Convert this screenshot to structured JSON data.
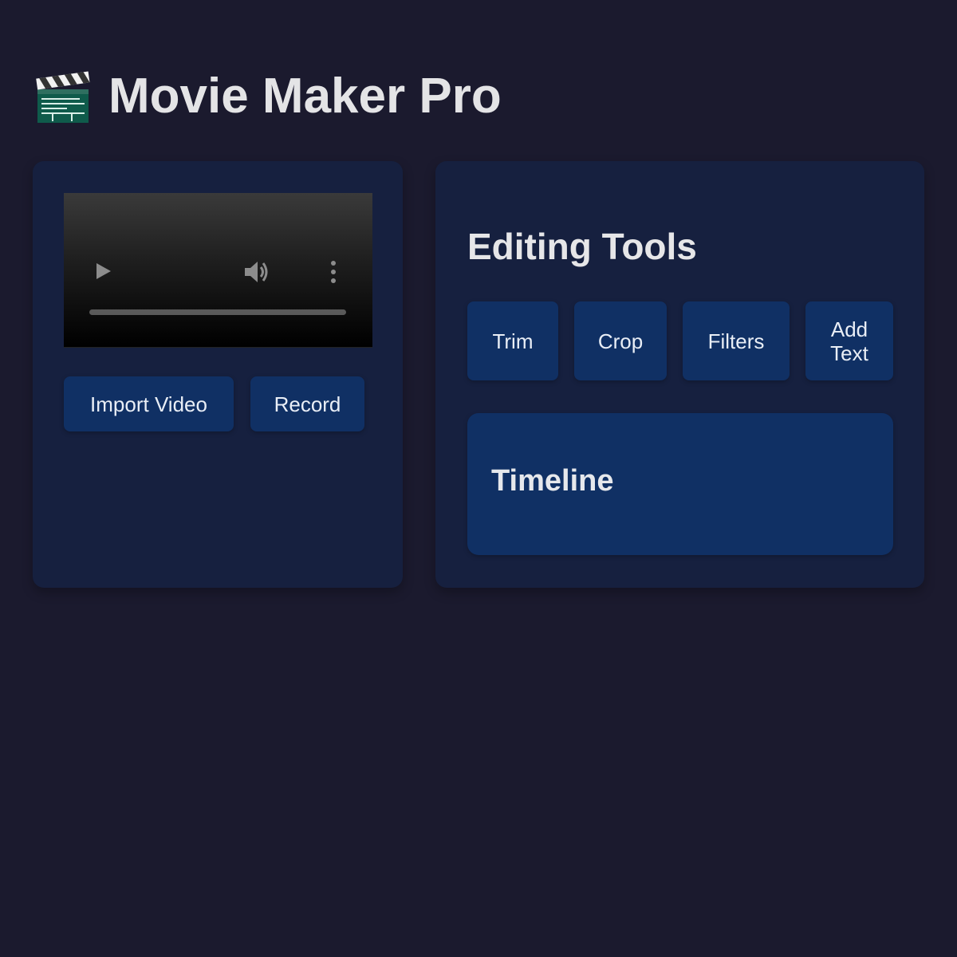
{
  "app": {
    "title": "Movie Maker Pro",
    "logo_icon": "clapperboard-icon"
  },
  "player": {
    "play_icon": "play-icon",
    "volume_icon": "volume-icon",
    "more_icon": "more-vertical-icon",
    "progress": 0
  },
  "media_actions": {
    "import_label": "Import Video",
    "record_label": "Record"
  },
  "editing_tools": {
    "title": "Editing Tools",
    "tools": [
      {
        "label": "Trim"
      },
      {
        "label": "Crop"
      },
      {
        "label": "Filters"
      },
      {
        "label": "Add Text"
      }
    ]
  },
  "timeline": {
    "title": "Timeline"
  },
  "colors": {
    "background": "#1b1a2e",
    "panel": "#16203f",
    "button": "#103064",
    "text": "#e6e6e6",
    "logo_green": "#0e5a4a"
  }
}
